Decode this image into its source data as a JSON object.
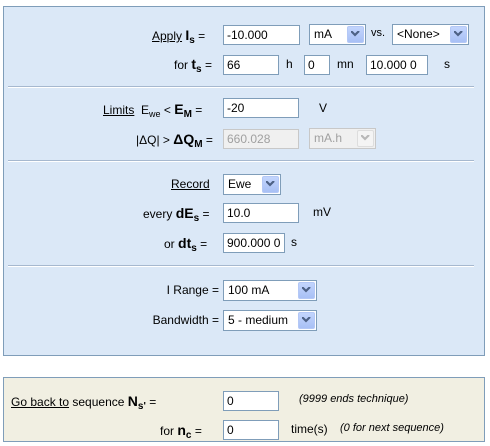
{
  "apply": {
    "link": "Apply",
    "symbol": "I",
    "sub": "s",
    "eq": "=",
    "value": "-10.000",
    "unit_select": "mA",
    "vs_label": "vs.",
    "vs_select": "<None>"
  },
  "duration": {
    "label": "for",
    "symbol": "t",
    "sub": "s",
    "eq": "=",
    "hours": "66",
    "h": "h",
    "minutes": "0",
    "mn": "mn",
    "seconds": "10.000 0",
    "s": "s"
  },
  "limits": {
    "link": "Limits",
    "ewe": "E",
    "ewe_sub": "we",
    "lt": "<",
    "symbol": "E",
    "sub": "M",
    "eq": "=",
    "value": "-20",
    "unit": "V"
  },
  "charge": {
    "prefix": "|ΔQ| >",
    "symbol": "ΔQ",
    "sub": "M",
    "eq": "=",
    "value": "660.028",
    "unit_select": "mA.h"
  },
  "record": {
    "link": "Record",
    "select": "Ewe",
    "every_label": "every",
    "de_symbol": "dE",
    "de_sub": "s",
    "eq": "=",
    "de_value": "10.0",
    "de_unit": "mV",
    "or_label": "or",
    "dt_symbol": "dt",
    "dt_sub": "s",
    "dt_value": "900.000 0",
    "dt_unit": "s"
  },
  "irange": {
    "label": "I Range =",
    "select": "100 mA"
  },
  "bandwidth": {
    "label": "Bandwidth =",
    "select": "5 - medium"
  },
  "goback": {
    "link": "Go back to",
    "seq_label": "sequence",
    "symbol": "N",
    "sub": "s'",
    "eq": "=",
    "value": "0",
    "hint": "(9999 ends technique)"
  },
  "cycles": {
    "for": "for",
    "symbol": "n",
    "sub": "c",
    "eq": "=",
    "value": "0",
    "times": "time(s)",
    "hint": "(0 for next sequence)"
  }
}
